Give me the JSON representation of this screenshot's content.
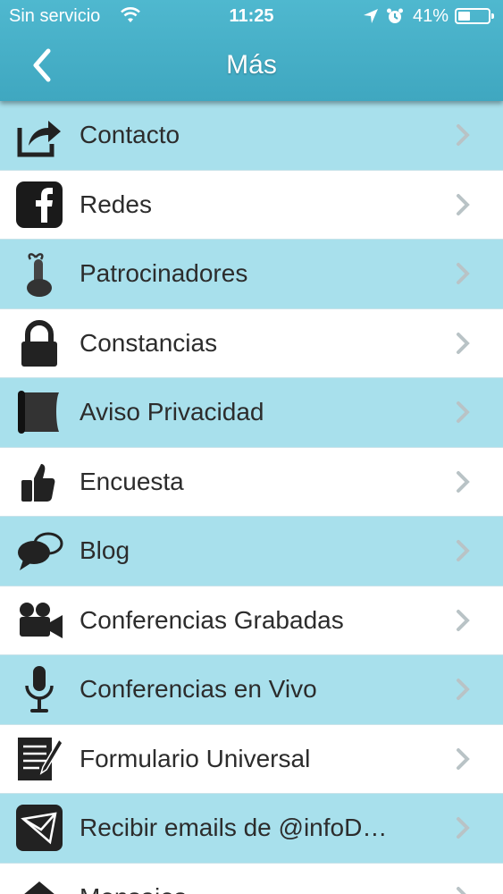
{
  "status_bar": {
    "carrier": "Sin servicio",
    "time": "11:25",
    "battery_percent": "41%",
    "battery_level": 0.41
  },
  "nav": {
    "title": "Más",
    "back_icon": "chevron-left-icon"
  },
  "colors": {
    "header": "#45adc5",
    "row_blue": "#a8e0ec",
    "row_white": "#ffffff",
    "text": "#2c2c2c",
    "chevron": "#b9c3c6"
  },
  "menu": {
    "items": [
      {
        "label": "Contacto",
        "icon": "share-icon"
      },
      {
        "label": "Redes",
        "icon": "facebook-icon"
      },
      {
        "label": "Patrocinadores",
        "icon": "finger-ribbon-icon"
      },
      {
        "label": "Constancias",
        "icon": "lock-icon"
      },
      {
        "label": "Aviso Privacidad",
        "icon": "scroll-icon"
      },
      {
        "label": "Encuesta",
        "icon": "thumbs-up-icon"
      },
      {
        "label": "Blog",
        "icon": "chat-bubbles-icon"
      },
      {
        "label": "Conferencias Grabadas",
        "icon": "video-camera-icon"
      },
      {
        "label": "Conferencias en Vivo",
        "icon": "microphone-icon"
      },
      {
        "label": "Formulario Universal",
        "icon": "document-pen-icon"
      },
      {
        "label": "Recibir emails de @infoD…",
        "icon": "envelope-icon"
      },
      {
        "label": "Mensajes",
        "icon": "message-icon"
      }
    ]
  }
}
